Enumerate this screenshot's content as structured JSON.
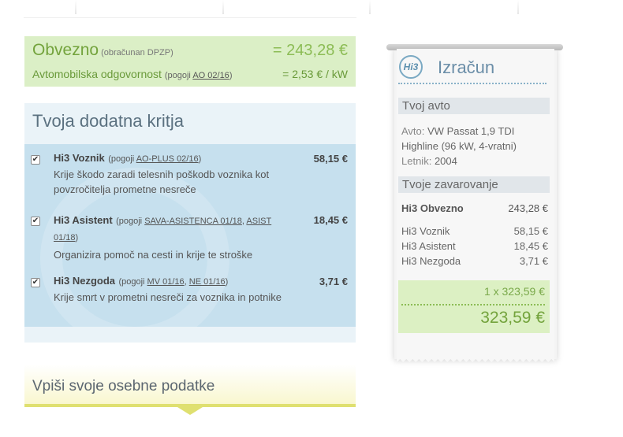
{
  "obvezno": {
    "title": "Obvezno",
    "subtitle": "(obračunan DPZP)",
    "amount": "= 243,28 €",
    "ao_label": "Avtomobilska odgovornost",
    "ao_cond_prefix": "(pogoji ",
    "ao_cond_link": "AO 02/16",
    "ao_cond_suffix": ")",
    "per_kw": "= 2,53 € / kW"
  },
  "dodatna": {
    "title": "Tvoja dodatna kritja",
    "items": [
      {
        "name": "Hi3 Voznik",
        "cond_prefix": "(pogoji ",
        "links": [
          "AO-PLUS 02/16"
        ],
        "cond_suffix": ")",
        "desc": "Krije škodo zaradi telesnih poškodb voznika kot povzročitelja prometne nesreče",
        "price": "58,15 €",
        "checked": true
      },
      {
        "name": "Hi3 Asistent",
        "cond_prefix": "(pogoji ",
        "links": [
          "SAVA-ASISTENCA 01/18",
          "ASIST 01/18"
        ],
        "cond_sep": ", ",
        "cond_suffix": ")",
        "desc": "Organizira pomoč na cesti in krije te stroške",
        "price": "18,45 €",
        "checked": true
      },
      {
        "name": "Hi3 Nezgoda",
        "cond_prefix": "(pogoji ",
        "links": [
          "MV 01/16",
          "NE 01/16"
        ],
        "cond_sep": ", ",
        "cond_suffix": ")",
        "desc": "Krije smrt v prometni nesreči za voznika in potnike",
        "price": "3,71 €",
        "checked": true
      }
    ]
  },
  "vpisi": {
    "title": "Vpiši svoje osebne podatke"
  },
  "receipt": {
    "logo_text": "Hi3",
    "title": "Izračun",
    "car_section": "Tvoj avto",
    "car": {
      "avto_label": "Avto:",
      "avto_value": "VW Passat 1,9 TDI Highline (96 kW, 4-vratni)",
      "letnik_label": "Letnik:",
      "letnik_value": "2004"
    },
    "ins_section": "Tvoje zavarovanje",
    "main_name": "Hi3 Obvezno",
    "main_amount": "243,28 €",
    "lines": [
      {
        "name": "Hi3 Voznik",
        "amount": "58,15 €"
      },
      {
        "name": "Hi3 Asistent",
        "amount": "18,45 €"
      },
      {
        "name": "Hi3 Nezgoda",
        "amount": "3,71 €"
      }
    ],
    "qty_total": "1 x 323,59 €",
    "total": "323,59 €"
  },
  "colors": {
    "green_bg": "#dbefc6",
    "green_text": "#73a33c",
    "blue_bg": "#c6e0ee",
    "receipt_bg": "#f7f7f7"
  }
}
